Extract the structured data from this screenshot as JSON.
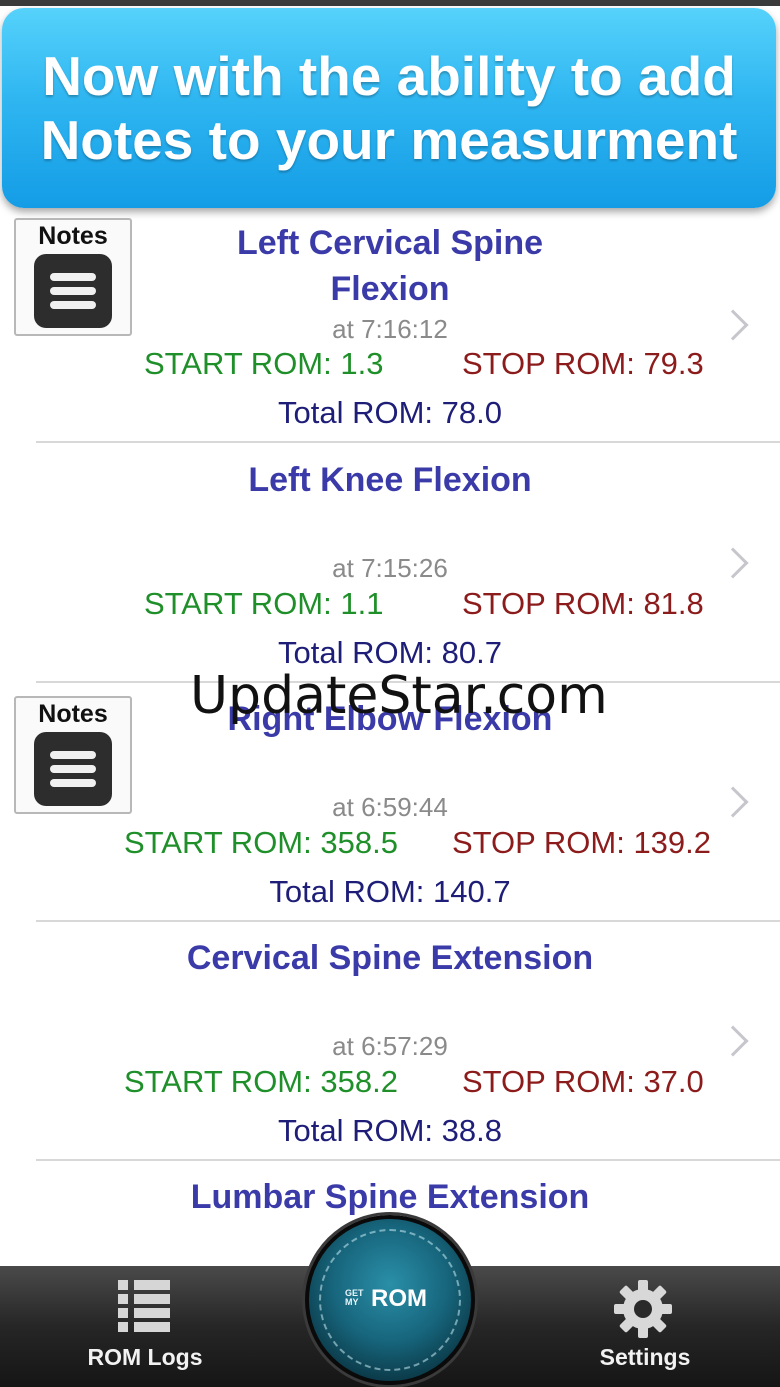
{
  "banner": {
    "line1": "Now with the ability to add",
    "line2": "Notes to your measurment"
  },
  "notes_label": "Notes",
  "entries": [
    {
      "title_line1": "Left Cervical Spine",
      "title_line2": "Flexion",
      "time": "at 7:16:12",
      "start": "START ROM: 1.3",
      "stop": "STOP ROM: 79.3",
      "total": "Total ROM: 78.0",
      "has_notes": true
    },
    {
      "title_line1": "Left Knee Flexion",
      "time": "at 7:15:26",
      "start": "START ROM: 1.1",
      "stop": "STOP ROM: 81.8",
      "total": "Total ROM: 80.7",
      "has_notes": false
    },
    {
      "title_line1": "Right Elbow Flexion",
      "time": "at 6:59:44",
      "start": "START ROM: 358.5",
      "stop": "STOP ROM: 139.2",
      "total": "Total ROM: 140.7",
      "has_notes": true
    },
    {
      "title_line1": "Cervical Spine Extension",
      "time": "at 6:57:29",
      "start": "START ROM: 358.2",
      "stop": "STOP ROM: 37.0",
      "total": "Total ROM: 38.8",
      "has_notes": false
    },
    {
      "title_line1": "Lumbar Spine Extension",
      "has_notes": false
    }
  ],
  "watermark": "UpdateStar.com",
  "tabbar": {
    "rom_logs_label": "ROM Logs",
    "settings_label": "Settings",
    "center_logo_small": "GET MY",
    "center_logo_main": "ROM",
    "rom_logs_icon": "list-icon",
    "settings_icon": "gear-icon"
  },
  "colors": {
    "banner": "#2fb6f1",
    "title": "#3a3aa8",
    "start": "#1f8f2a",
    "stop": "#8c1c1c",
    "total": "#1e1e78"
  }
}
